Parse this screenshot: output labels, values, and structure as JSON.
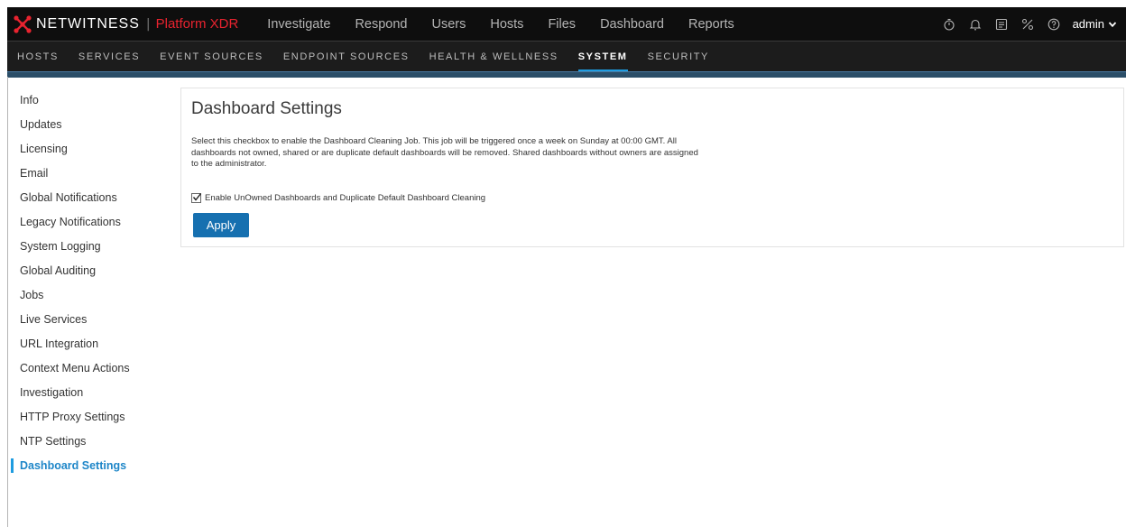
{
  "brand": {
    "name": "NETWITNESS",
    "separator": "|",
    "product": "Platform XDR"
  },
  "top_nav": [
    "Investigate",
    "Respond",
    "Users",
    "Hosts",
    "Files",
    "Dashboard",
    "Reports"
  ],
  "top_icons": [
    "stopwatch-icon",
    "bell-icon",
    "tasks-icon",
    "admin-tools-icon",
    "help-icon"
  ],
  "user": {
    "name": "admin"
  },
  "sub_nav": [
    "HOSTS",
    "SERVICES",
    "EVENT SOURCES",
    "ENDPOINT SOURCES",
    "HEALTH & WELLNESS",
    "SYSTEM",
    "SECURITY"
  ],
  "sub_nav_active": "SYSTEM",
  "sidebar": {
    "items": [
      "Info",
      "Updates",
      "Licensing",
      "Email",
      "Global Notifications",
      "Legacy Notifications",
      "System Logging",
      "Global Auditing",
      "Jobs",
      "Live Services",
      "URL Integration",
      "Context Menu Actions",
      "Investigation",
      "HTTP Proxy Settings",
      "NTP Settings",
      "Dashboard Settings"
    ],
    "active": "Dashboard Settings"
  },
  "panel": {
    "title": "Dashboard Settings",
    "description_lines": [
      "Select this checkbox to enable the Dashboard Cleaning Job. This job will be triggered once a week on Sunday at 00:00 GMT. All",
      "dashboards not owned, shared or are duplicate default dashboards will be removed. Shared dashboards without owners are assigned",
      "to the administrator."
    ],
    "checkbox_label": "Enable UnOwned Dashboards and Duplicate Default Dashboard Cleaning",
    "checkbox_checked": true,
    "apply_label": "Apply"
  },
  "colors": {
    "accent": "#1e9ce0",
    "brand_red": "#e8232f",
    "button": "#1670b0",
    "topbar": "#0e0e0e"
  }
}
